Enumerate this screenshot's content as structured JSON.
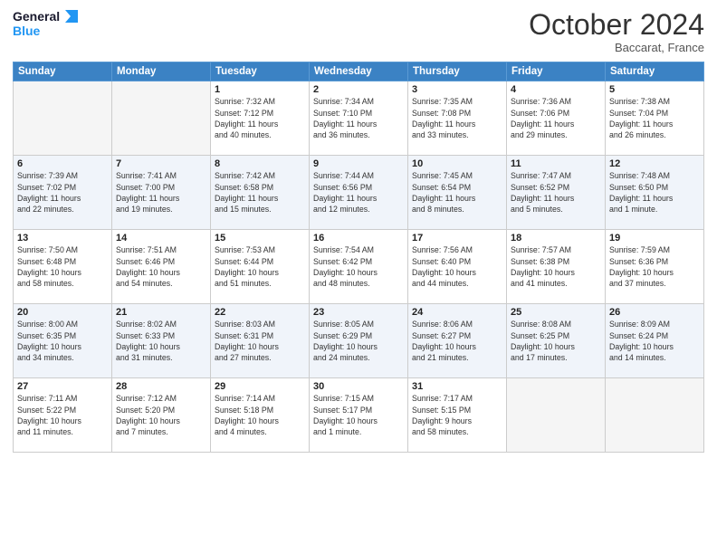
{
  "header": {
    "logo_line1": "General",
    "logo_line2": "Blue",
    "month": "October 2024",
    "location": "Baccarat, France"
  },
  "days_of_week": [
    "Sunday",
    "Monday",
    "Tuesday",
    "Wednesday",
    "Thursday",
    "Friday",
    "Saturday"
  ],
  "weeks": [
    [
      {
        "day": "",
        "empty": true
      },
      {
        "day": "",
        "empty": true
      },
      {
        "day": "1",
        "line1": "Sunrise: 7:32 AM",
        "line2": "Sunset: 7:12 PM",
        "line3": "Daylight: 11 hours",
        "line4": "and 40 minutes."
      },
      {
        "day": "2",
        "line1": "Sunrise: 7:34 AM",
        "line2": "Sunset: 7:10 PM",
        "line3": "Daylight: 11 hours",
        "line4": "and 36 minutes."
      },
      {
        "day": "3",
        "line1": "Sunrise: 7:35 AM",
        "line2": "Sunset: 7:08 PM",
        "line3": "Daylight: 11 hours",
        "line4": "and 33 minutes."
      },
      {
        "day": "4",
        "line1": "Sunrise: 7:36 AM",
        "line2": "Sunset: 7:06 PM",
        "line3": "Daylight: 11 hours",
        "line4": "and 29 minutes."
      },
      {
        "day": "5",
        "line1": "Sunrise: 7:38 AM",
        "line2": "Sunset: 7:04 PM",
        "line3": "Daylight: 11 hours",
        "line4": "and 26 minutes."
      }
    ],
    [
      {
        "day": "6",
        "line1": "Sunrise: 7:39 AM",
        "line2": "Sunset: 7:02 PM",
        "line3": "Daylight: 11 hours",
        "line4": "and 22 minutes."
      },
      {
        "day": "7",
        "line1": "Sunrise: 7:41 AM",
        "line2": "Sunset: 7:00 PM",
        "line3": "Daylight: 11 hours",
        "line4": "and 19 minutes."
      },
      {
        "day": "8",
        "line1": "Sunrise: 7:42 AM",
        "line2": "Sunset: 6:58 PM",
        "line3": "Daylight: 11 hours",
        "line4": "and 15 minutes."
      },
      {
        "day": "9",
        "line1": "Sunrise: 7:44 AM",
        "line2": "Sunset: 6:56 PM",
        "line3": "Daylight: 11 hours",
        "line4": "and 12 minutes."
      },
      {
        "day": "10",
        "line1": "Sunrise: 7:45 AM",
        "line2": "Sunset: 6:54 PM",
        "line3": "Daylight: 11 hours",
        "line4": "and 8 minutes."
      },
      {
        "day": "11",
        "line1": "Sunrise: 7:47 AM",
        "line2": "Sunset: 6:52 PM",
        "line3": "Daylight: 11 hours",
        "line4": "and 5 minutes."
      },
      {
        "day": "12",
        "line1": "Sunrise: 7:48 AM",
        "line2": "Sunset: 6:50 PM",
        "line3": "Daylight: 11 hours",
        "line4": "and 1 minute."
      }
    ],
    [
      {
        "day": "13",
        "line1": "Sunrise: 7:50 AM",
        "line2": "Sunset: 6:48 PM",
        "line3": "Daylight: 10 hours",
        "line4": "and 58 minutes."
      },
      {
        "day": "14",
        "line1": "Sunrise: 7:51 AM",
        "line2": "Sunset: 6:46 PM",
        "line3": "Daylight: 10 hours",
        "line4": "and 54 minutes."
      },
      {
        "day": "15",
        "line1": "Sunrise: 7:53 AM",
        "line2": "Sunset: 6:44 PM",
        "line3": "Daylight: 10 hours",
        "line4": "and 51 minutes."
      },
      {
        "day": "16",
        "line1": "Sunrise: 7:54 AM",
        "line2": "Sunset: 6:42 PM",
        "line3": "Daylight: 10 hours",
        "line4": "and 48 minutes."
      },
      {
        "day": "17",
        "line1": "Sunrise: 7:56 AM",
        "line2": "Sunset: 6:40 PM",
        "line3": "Daylight: 10 hours",
        "line4": "and 44 minutes."
      },
      {
        "day": "18",
        "line1": "Sunrise: 7:57 AM",
        "line2": "Sunset: 6:38 PM",
        "line3": "Daylight: 10 hours",
        "line4": "and 41 minutes."
      },
      {
        "day": "19",
        "line1": "Sunrise: 7:59 AM",
        "line2": "Sunset: 6:36 PM",
        "line3": "Daylight: 10 hours",
        "line4": "and 37 minutes."
      }
    ],
    [
      {
        "day": "20",
        "line1": "Sunrise: 8:00 AM",
        "line2": "Sunset: 6:35 PM",
        "line3": "Daylight: 10 hours",
        "line4": "and 34 minutes."
      },
      {
        "day": "21",
        "line1": "Sunrise: 8:02 AM",
        "line2": "Sunset: 6:33 PM",
        "line3": "Daylight: 10 hours",
        "line4": "and 31 minutes."
      },
      {
        "day": "22",
        "line1": "Sunrise: 8:03 AM",
        "line2": "Sunset: 6:31 PM",
        "line3": "Daylight: 10 hours",
        "line4": "and 27 minutes."
      },
      {
        "day": "23",
        "line1": "Sunrise: 8:05 AM",
        "line2": "Sunset: 6:29 PM",
        "line3": "Daylight: 10 hours",
        "line4": "and 24 minutes."
      },
      {
        "day": "24",
        "line1": "Sunrise: 8:06 AM",
        "line2": "Sunset: 6:27 PM",
        "line3": "Daylight: 10 hours",
        "line4": "and 21 minutes."
      },
      {
        "day": "25",
        "line1": "Sunrise: 8:08 AM",
        "line2": "Sunset: 6:25 PM",
        "line3": "Daylight: 10 hours",
        "line4": "and 17 minutes."
      },
      {
        "day": "26",
        "line1": "Sunrise: 8:09 AM",
        "line2": "Sunset: 6:24 PM",
        "line3": "Daylight: 10 hours",
        "line4": "and 14 minutes."
      }
    ],
    [
      {
        "day": "27",
        "line1": "Sunrise: 7:11 AM",
        "line2": "Sunset: 5:22 PM",
        "line3": "Daylight: 10 hours",
        "line4": "and 11 minutes."
      },
      {
        "day": "28",
        "line1": "Sunrise: 7:12 AM",
        "line2": "Sunset: 5:20 PM",
        "line3": "Daylight: 10 hours",
        "line4": "and 7 minutes."
      },
      {
        "day": "29",
        "line1": "Sunrise: 7:14 AM",
        "line2": "Sunset: 5:18 PM",
        "line3": "Daylight: 10 hours",
        "line4": "and 4 minutes."
      },
      {
        "day": "30",
        "line1": "Sunrise: 7:15 AM",
        "line2": "Sunset: 5:17 PM",
        "line3": "Daylight: 10 hours",
        "line4": "and 1 minute."
      },
      {
        "day": "31",
        "line1": "Sunrise: 7:17 AM",
        "line2": "Sunset: 5:15 PM",
        "line3": "Daylight: 9 hours",
        "line4": "and 58 minutes."
      },
      {
        "day": "",
        "empty": true
      },
      {
        "day": "",
        "empty": true
      }
    ]
  ]
}
